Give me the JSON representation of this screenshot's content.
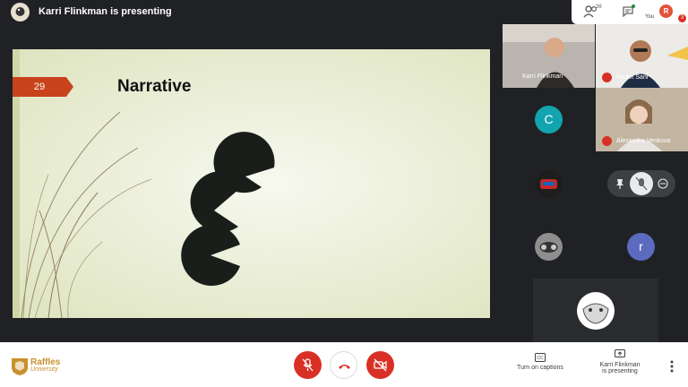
{
  "header": {
    "presenting_title": "Karri Flinkman is presenting",
    "participants_count": "36",
    "you_initial": "R",
    "you_label": "You",
    "notification_count": "3"
  },
  "slide": {
    "number": "29",
    "title": "Narrative"
  },
  "participants": [
    {
      "name": "Karri Flinkman"
    },
    {
      "name": "Syukri Sani"
    },
    {
      "name": "Alexandra Venkova"
    },
    {
      "initial": "C",
      "color": "#12a4af"
    },
    {
      "initial": "r",
      "color": "#5c6bc0"
    }
  ],
  "bottom": {
    "org_name": "Raffles",
    "org_sub": "University",
    "captions_label": "Turn on captions",
    "presenting_line1": "Karri Flinkman",
    "presenting_line2": "is presenting"
  },
  "colors": {
    "accent_red": "#d93025",
    "slide_number_bg": "#c8431b",
    "brand_gold": "#c8912c"
  }
}
